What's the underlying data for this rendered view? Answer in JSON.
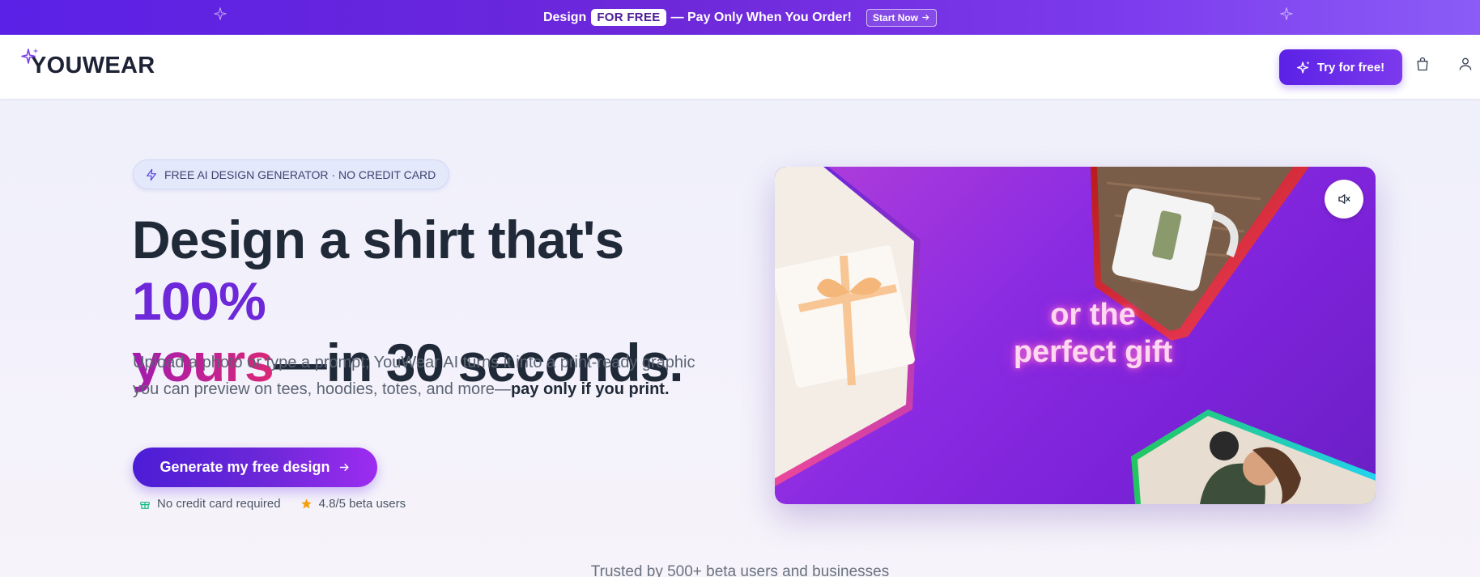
{
  "promo": {
    "prefix": "Design",
    "badge": "FOR FREE",
    "suffix": "— Pay Only When You Order!",
    "button": "Start Now"
  },
  "header": {
    "logo": "YOUWEAR",
    "try_button": "Try for free!"
  },
  "hero": {
    "pill": "FREE AI DESIGN GENERATOR · NO CREDIT CARD",
    "headline": {
      "part1": "Design a shirt that's ",
      "highlight1": "100%",
      "highlight2": "yours",
      "part2": "—in 30 seconds."
    },
    "subtext": {
      "main": "Upload a photo or type a prompt; YouWear AI turns it into a print-ready graphic you can preview on tees, hoodies, totes, and more—",
      "bold": "pay only if you print."
    },
    "cta": "Generate my free design",
    "trust": {
      "item1": "No credit card required",
      "item2": "4.8/5 beta users"
    }
  },
  "video": {
    "caption_line1": "or the",
    "caption_line2": "perfect gift"
  },
  "trusted": "Trusted by 500+ beta users and businesses",
  "colors": {
    "brand": "#6d28d9",
    "accent_pink": "#db2777",
    "promo_bg": "#5b21e6"
  },
  "icons": {
    "promo_sparkle": "sparkle-icon",
    "bag": "shopping-bag-icon",
    "user": "user-icon",
    "mute": "volume-mute-icon",
    "pill": "lightning-icon",
    "cta": "arrow-right-icon",
    "no_card": "gift-icon",
    "rating": "star-icon"
  }
}
